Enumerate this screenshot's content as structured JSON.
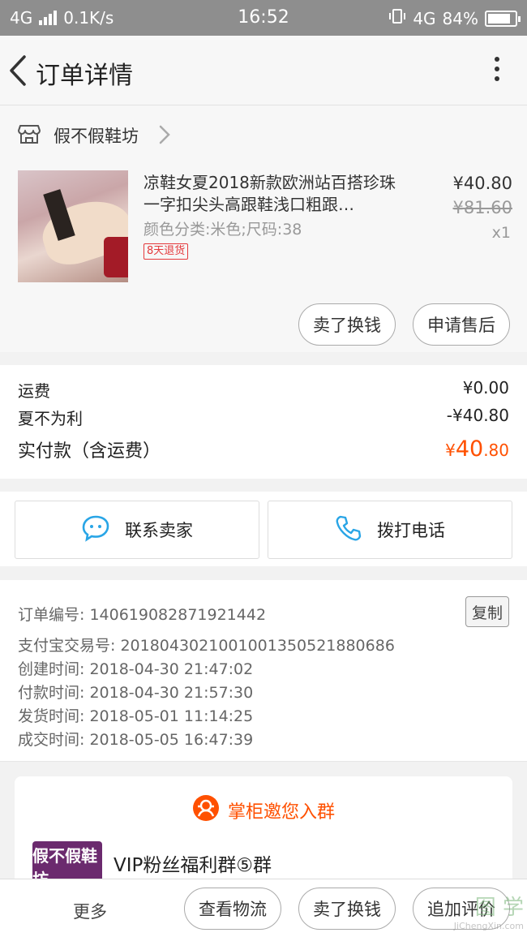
{
  "status_bar": {
    "network": "4G",
    "speed": "0.1K/s",
    "time": "16:52",
    "network2": "4G",
    "battery": "84%",
    "battery_level": 0.84
  },
  "nav": {
    "title": "订单详情"
  },
  "shop": {
    "name": "假不假鞋坊"
  },
  "item": {
    "name": "凉鞋女夏2018新款欧洲站百搭珍珠一字扣尖头高跟鞋浅口粗跟…",
    "sku": "颜色分类:米色;尺码:38",
    "tag": "8天退货",
    "price": "¥40.80",
    "original_price": "¥81.60",
    "quantity": "x1",
    "btn_sell": "卖了换钱",
    "btn_after_sale": "申请售后"
  },
  "fees": {
    "shipping_label": "运费",
    "shipping_value": "¥0.00",
    "discount_label": "夏不为利",
    "discount_value": "-¥40.80",
    "total_label": "实付款（含运费）",
    "total_currency": "¥",
    "total_int": "40",
    "total_dec": ".80"
  },
  "contact": {
    "chat_label": "联系卖家",
    "call_label": "拨打电话"
  },
  "order_info": {
    "order_no": "订单编号: 140619082871921442",
    "alipay_no": "支付宝交易号: 2018043021001001350521880686",
    "created": "创建时间: 2018-04-30 21:47:02",
    "paid": "付款时间: 2018-04-30 21:57:30",
    "shipped": "发货时间: 2018-05-01 11:14:25",
    "completed": "成交时间: 2018-05-05 16:47:39",
    "copy_label": "复制"
  },
  "group_invite": {
    "title": "掌柜邀您入群",
    "logo_text": "假不假鞋坊",
    "group_name": "VIP粉丝福利群⑤群"
  },
  "bottom_bar": {
    "more": "更多",
    "logistics": "查看物流",
    "sell": "卖了换钱",
    "review": "追加评价"
  },
  "watermark": {
    "top": "图 学",
    "bottom": "JiChengXin.com"
  },
  "colors": {
    "accent": "#ff5000",
    "status_bar": "#8e8e8e",
    "tag_red": "#e4393c",
    "icon_blue": "#29a5e6"
  }
}
